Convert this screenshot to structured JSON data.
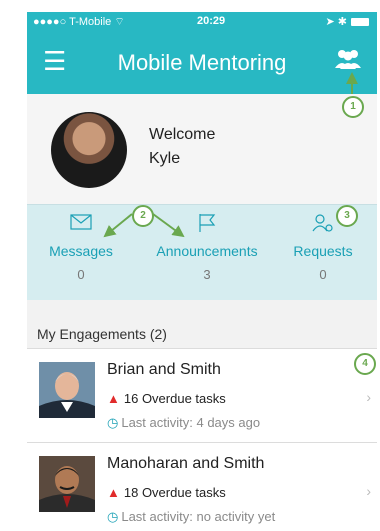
{
  "status": {
    "carrier": "T-Mobile",
    "time": "20:29"
  },
  "header": {
    "title": "Mobile Mentoring"
  },
  "welcome": {
    "greeting": "Welcome",
    "name": "Kyle"
  },
  "counters": [
    {
      "label": "Messages",
      "value": "0"
    },
    {
      "label": "Announcements",
      "value": "3"
    },
    {
      "label": "Requests",
      "value": "0"
    }
  ],
  "engagements": {
    "header": "My Engagements (2)",
    "items": [
      {
        "name": "Brian and Smith",
        "overdue": "16 Overdue tasks",
        "activity": "Last activity: 4 days ago"
      },
      {
        "name": "Manoharan and Smith",
        "overdue": "18 Overdue tasks",
        "activity": "Last activity: no activity yet"
      }
    ]
  },
  "callouts": [
    "1",
    "2",
    "3",
    "4"
  ],
  "colors": {
    "primary": "#28b8c3",
    "accent_text": "#1aa0b5",
    "annotation": "#6aa84f",
    "warning": "#e12b2b"
  }
}
